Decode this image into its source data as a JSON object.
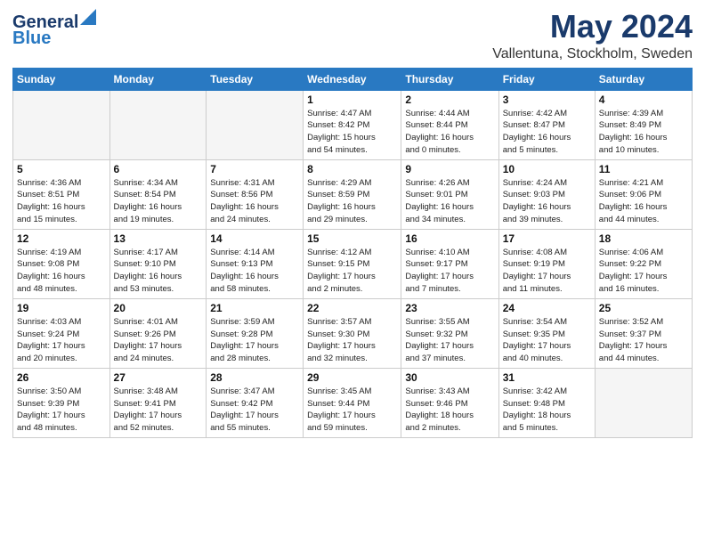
{
  "header": {
    "logo_line1": "General",
    "logo_line2": "Blue",
    "title": "May 2024",
    "subtitle": "Vallentuna, Stockholm, Sweden"
  },
  "weekdays": [
    "Sunday",
    "Monday",
    "Tuesday",
    "Wednesday",
    "Thursday",
    "Friday",
    "Saturday"
  ],
  "weeks": [
    [
      {
        "day": "",
        "info": ""
      },
      {
        "day": "",
        "info": ""
      },
      {
        "day": "",
        "info": ""
      },
      {
        "day": "1",
        "info": "Sunrise: 4:47 AM\nSunset: 8:42 PM\nDaylight: 15 hours\nand 54 minutes."
      },
      {
        "day": "2",
        "info": "Sunrise: 4:44 AM\nSunset: 8:44 PM\nDaylight: 16 hours\nand 0 minutes."
      },
      {
        "day": "3",
        "info": "Sunrise: 4:42 AM\nSunset: 8:47 PM\nDaylight: 16 hours\nand 5 minutes."
      },
      {
        "day": "4",
        "info": "Sunrise: 4:39 AM\nSunset: 8:49 PM\nDaylight: 16 hours\nand 10 minutes."
      }
    ],
    [
      {
        "day": "5",
        "info": "Sunrise: 4:36 AM\nSunset: 8:51 PM\nDaylight: 16 hours\nand 15 minutes."
      },
      {
        "day": "6",
        "info": "Sunrise: 4:34 AM\nSunset: 8:54 PM\nDaylight: 16 hours\nand 19 minutes."
      },
      {
        "day": "7",
        "info": "Sunrise: 4:31 AM\nSunset: 8:56 PM\nDaylight: 16 hours\nand 24 minutes."
      },
      {
        "day": "8",
        "info": "Sunrise: 4:29 AM\nSunset: 8:59 PM\nDaylight: 16 hours\nand 29 minutes."
      },
      {
        "day": "9",
        "info": "Sunrise: 4:26 AM\nSunset: 9:01 PM\nDaylight: 16 hours\nand 34 minutes."
      },
      {
        "day": "10",
        "info": "Sunrise: 4:24 AM\nSunset: 9:03 PM\nDaylight: 16 hours\nand 39 minutes."
      },
      {
        "day": "11",
        "info": "Sunrise: 4:21 AM\nSunset: 9:06 PM\nDaylight: 16 hours\nand 44 minutes."
      }
    ],
    [
      {
        "day": "12",
        "info": "Sunrise: 4:19 AM\nSunset: 9:08 PM\nDaylight: 16 hours\nand 48 minutes."
      },
      {
        "day": "13",
        "info": "Sunrise: 4:17 AM\nSunset: 9:10 PM\nDaylight: 16 hours\nand 53 minutes."
      },
      {
        "day": "14",
        "info": "Sunrise: 4:14 AM\nSunset: 9:13 PM\nDaylight: 16 hours\nand 58 minutes."
      },
      {
        "day": "15",
        "info": "Sunrise: 4:12 AM\nSunset: 9:15 PM\nDaylight: 17 hours\nand 2 minutes."
      },
      {
        "day": "16",
        "info": "Sunrise: 4:10 AM\nSunset: 9:17 PM\nDaylight: 17 hours\nand 7 minutes."
      },
      {
        "day": "17",
        "info": "Sunrise: 4:08 AM\nSunset: 9:19 PM\nDaylight: 17 hours\nand 11 minutes."
      },
      {
        "day": "18",
        "info": "Sunrise: 4:06 AM\nSunset: 9:22 PM\nDaylight: 17 hours\nand 16 minutes."
      }
    ],
    [
      {
        "day": "19",
        "info": "Sunrise: 4:03 AM\nSunset: 9:24 PM\nDaylight: 17 hours\nand 20 minutes."
      },
      {
        "day": "20",
        "info": "Sunrise: 4:01 AM\nSunset: 9:26 PM\nDaylight: 17 hours\nand 24 minutes."
      },
      {
        "day": "21",
        "info": "Sunrise: 3:59 AM\nSunset: 9:28 PM\nDaylight: 17 hours\nand 28 minutes."
      },
      {
        "day": "22",
        "info": "Sunrise: 3:57 AM\nSunset: 9:30 PM\nDaylight: 17 hours\nand 32 minutes."
      },
      {
        "day": "23",
        "info": "Sunrise: 3:55 AM\nSunset: 9:32 PM\nDaylight: 17 hours\nand 37 minutes."
      },
      {
        "day": "24",
        "info": "Sunrise: 3:54 AM\nSunset: 9:35 PM\nDaylight: 17 hours\nand 40 minutes."
      },
      {
        "day": "25",
        "info": "Sunrise: 3:52 AM\nSunset: 9:37 PM\nDaylight: 17 hours\nand 44 minutes."
      }
    ],
    [
      {
        "day": "26",
        "info": "Sunrise: 3:50 AM\nSunset: 9:39 PM\nDaylight: 17 hours\nand 48 minutes."
      },
      {
        "day": "27",
        "info": "Sunrise: 3:48 AM\nSunset: 9:41 PM\nDaylight: 17 hours\nand 52 minutes."
      },
      {
        "day": "28",
        "info": "Sunrise: 3:47 AM\nSunset: 9:42 PM\nDaylight: 17 hours\nand 55 minutes."
      },
      {
        "day": "29",
        "info": "Sunrise: 3:45 AM\nSunset: 9:44 PM\nDaylight: 17 hours\nand 59 minutes."
      },
      {
        "day": "30",
        "info": "Sunrise: 3:43 AM\nSunset: 9:46 PM\nDaylight: 18 hours\nand 2 minutes."
      },
      {
        "day": "31",
        "info": "Sunrise: 3:42 AM\nSunset: 9:48 PM\nDaylight: 18 hours\nand 5 minutes."
      },
      {
        "day": "",
        "info": ""
      }
    ]
  ]
}
